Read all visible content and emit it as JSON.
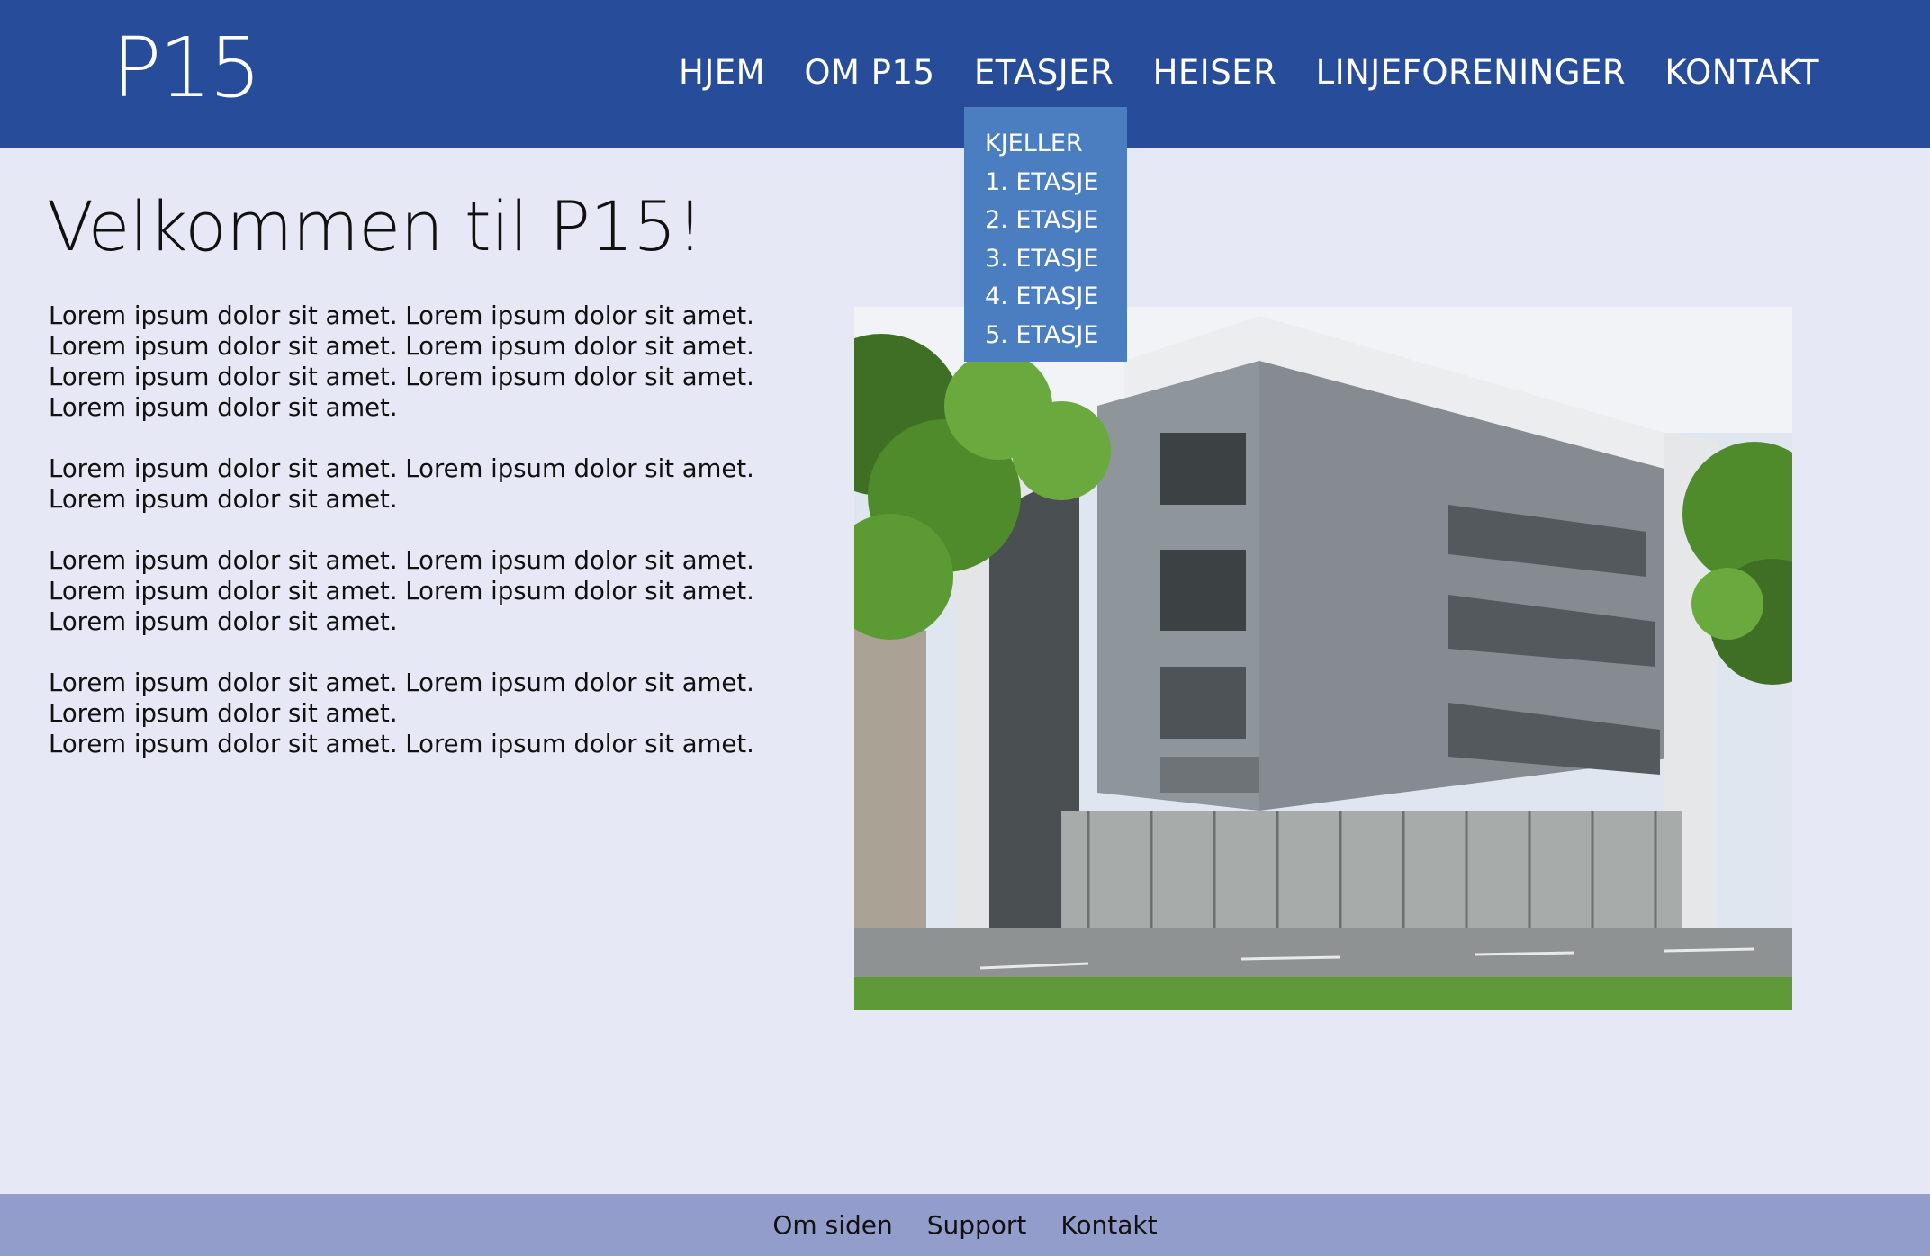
{
  "header": {
    "logo": "P15",
    "nav": [
      "HJEM",
      "OM P15",
      "ETASJER",
      "HEISER",
      "LINJEFORENINGER",
      "KONTAKT"
    ],
    "dropdown": [
      "KJELLER",
      "1. ETASJE",
      "2. ETASJE",
      "3. ETASJE",
      "4. ETASJE",
      "5. ETASJE"
    ]
  },
  "main": {
    "title": "Velkommen til P15!",
    "paragraphs": [
      "Lorem ipsum dolor sit amet. Lorem ipsum dolor sit amet. Lorem ipsum dolor sit amet. Lorem ipsum dolor sit amet. Lorem ipsum dolor sit amet. Lorem ipsum dolor sit amet. Lorem ipsum dolor sit amet.",
      "Lorem ipsum dolor sit amet. Lorem ipsum dolor sit amet. Lorem ipsum dolor sit amet.",
      "Lorem ipsum dolor sit amet. Lorem ipsum dolor sit amet. Lorem ipsum dolor sit amet. Lorem ipsum dolor sit amet. Lorem ipsum dolor sit amet.",
      "Lorem ipsum dolor sit amet. Lorem ipsum dolor sit amet. Lorem ipsum dolor sit amet.",
      "Lorem ipsum dolor sit amet. Lorem ipsum dolor sit amet."
    ]
  },
  "footer": {
    "links": [
      "Om siden",
      "Support",
      "Kontakt"
    ]
  },
  "colors": {
    "header_bg": "#274c9a",
    "dropdown_bg": "#4a7ec0",
    "page_bg": "#e6e9f5",
    "footer_bg": "#939dcc"
  }
}
